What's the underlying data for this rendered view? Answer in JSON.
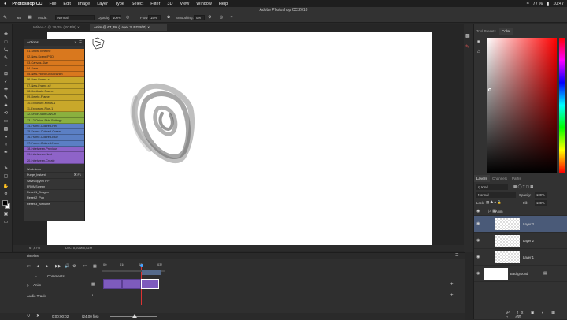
{
  "menubar": {
    "apple": "",
    "items": [
      "Photoshop CC",
      "File",
      "Edit",
      "Image",
      "Layer",
      "Type",
      "Select",
      "Filter",
      "3D",
      "View",
      "Window",
      "Help"
    ],
    "battery": "77 %",
    "time": "10:47"
  },
  "window_title": "Adobe Photoshop CC 2018",
  "options_bar": {
    "mode_label": "Mode:",
    "mode_value": "Normal",
    "opacity_label": "Opacity:",
    "opacity_value": "100%",
    "flow_label": "Flow:",
    "flow_value": "15%",
    "smoothing_label": "Smoothing:",
    "smoothing_value": "0%",
    "brush_size": "65"
  },
  "doc_tabs": [
    {
      "label": "Untitled-1 @ 29,3% (RGB/8) ×"
    },
    {
      "label": "Anim @ 67,3% (Layer 3, RGB/8*) ×"
    }
  ],
  "status": {
    "zoom": "67,67%",
    "doc": "Doc: 5,93M/6,82M"
  },
  "actions_panel": {
    "title": "Actions",
    "items": [
      {
        "label": "01-Show-Timeline",
        "color": "#d9781e"
      },
      {
        "label": "02-New-Scene/PSD",
        "color": "#d9781e"
      },
      {
        "label": "03-Canvas-Size",
        "color": "#d9781e"
      },
      {
        "label": "04-Save",
        "color": "#d9781e"
      },
      {
        "label": "05-New-Video-Group/Anim",
        "color": "#d9781e"
      },
      {
        "label": "06-New-Frame-x1",
        "color": "#c9a82a"
      },
      {
        "label": "07-New-Frame-x2",
        "color": "#c9a82a"
      },
      {
        "label": "08-Duplicate-Frame",
        "color": "#c9a82a"
      },
      {
        "label": "09-Delete-Frame",
        "color": "#c9a82a"
      },
      {
        "label": "10-Exposure-Minus-1",
        "color": "#c9a82a"
      },
      {
        "label": "11-Exposure-Plus-1",
        "color": "#c9a82a"
      },
      {
        "label": "12-Onion-Skin-On/Off",
        "color": "#8ab03f"
      },
      {
        "label": "13-12-Onion-Skin-Settings",
        "color": "#8ab03f"
      },
      {
        "label": "14-Frame-Colored-Red",
        "color": "#5b7fc4"
      },
      {
        "label": "15-Frame-Colored-Green",
        "color": "#5b7fc4"
      },
      {
        "label": "16-Frame-Colored-Blue",
        "color": "#5b7fc4"
      },
      {
        "label": "17-Frame-Colored-None",
        "color": "#5b7fc4"
      },
      {
        "label": "18-Inbetween-Previous",
        "color": "#8e63c8"
      },
      {
        "label": "19-Inbetween-Next",
        "color": "#8e63c8"
      },
      {
        "label": "20-Inbetween-Create",
        "color": "#8e63c8"
      }
    ],
    "plain_items": [
      "Work Area",
      "Purge_Instant",
      "SaveCopyInTIFF",
      "FROMScreen",
      "Reset-1_Dragon",
      "Reset-2_Pop",
      "Reset-3_Airplane"
    ],
    "shortcut": "⌘ F1"
  },
  "right_panels": {
    "color_tabs": [
      "Tool Presets",
      "Color"
    ],
    "layer_tabs": [
      "Layers",
      "Channels",
      "Paths"
    ],
    "kind_label": "Kind",
    "blend_mode": "Normal",
    "opacity_label": "Opacity:",
    "opacity_value": "100%",
    "lock_label": "Lock:",
    "fill_label": "Fill:",
    "fill_value": "100%",
    "group_name": "Anim",
    "layers": [
      {
        "name": "Layer 3",
        "selected": true
      },
      {
        "name": "Layer 2",
        "selected": false
      },
      {
        "name": "Layer 1",
        "selected": false
      }
    ],
    "background_name": "Background"
  },
  "timeline": {
    "title": "Timeline",
    "ruler": [
      "00",
      "01f",
      "02f",
      "03f"
    ],
    "comments_label": "Comments",
    "track_name": "Anim",
    "audio_label": "Audio Track",
    "timecode": "0:00:00:02",
    "fps": "(24,00 fps)"
  }
}
